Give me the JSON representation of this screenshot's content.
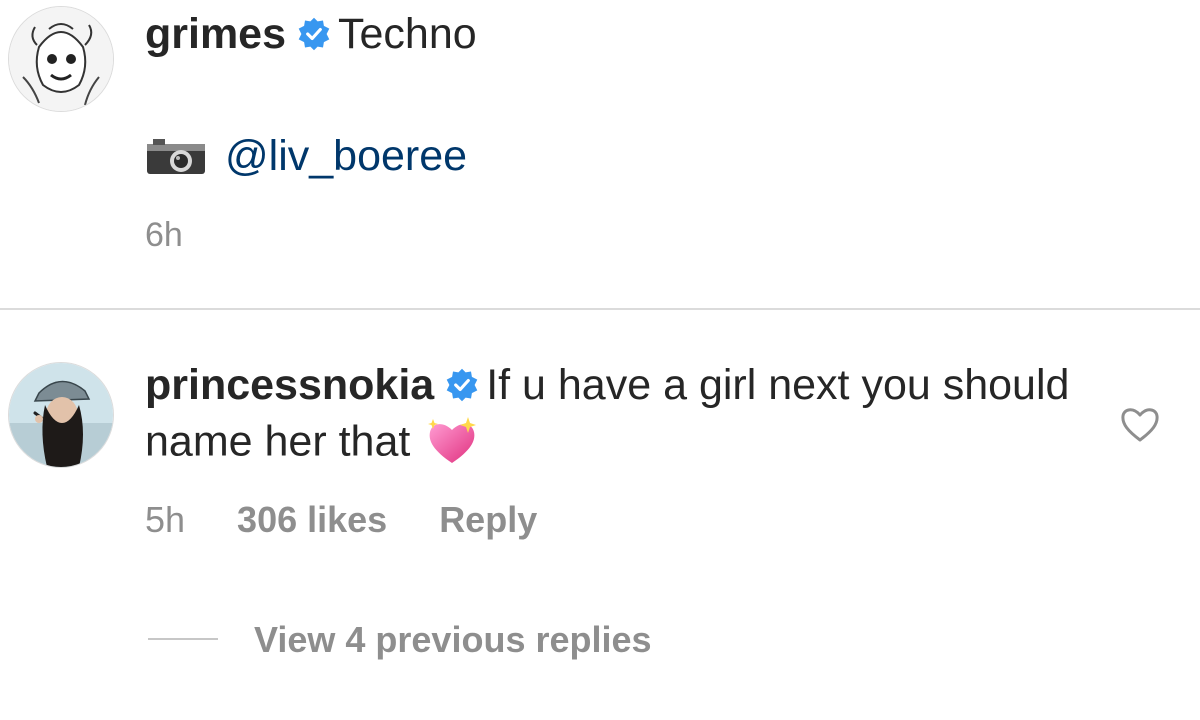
{
  "post": {
    "username": "grimes",
    "caption": "Techno",
    "camera_icon": "camera-icon",
    "mention": "@liv_boeree",
    "time": "6h"
  },
  "comment": {
    "username": "princessnokia",
    "text": "If u have a girl next you should name her that",
    "emoji": "sparkling-heart",
    "time": "5h",
    "likes": "306 likes",
    "reply_label": "Reply",
    "view_replies_label": "View 4 previous replies"
  },
  "colors": {
    "verified_blue": "#3897f0",
    "text_primary": "#262626",
    "text_secondary": "#8e8e8e",
    "mention_link": "#00376b",
    "divider": "#dbdbdb"
  }
}
